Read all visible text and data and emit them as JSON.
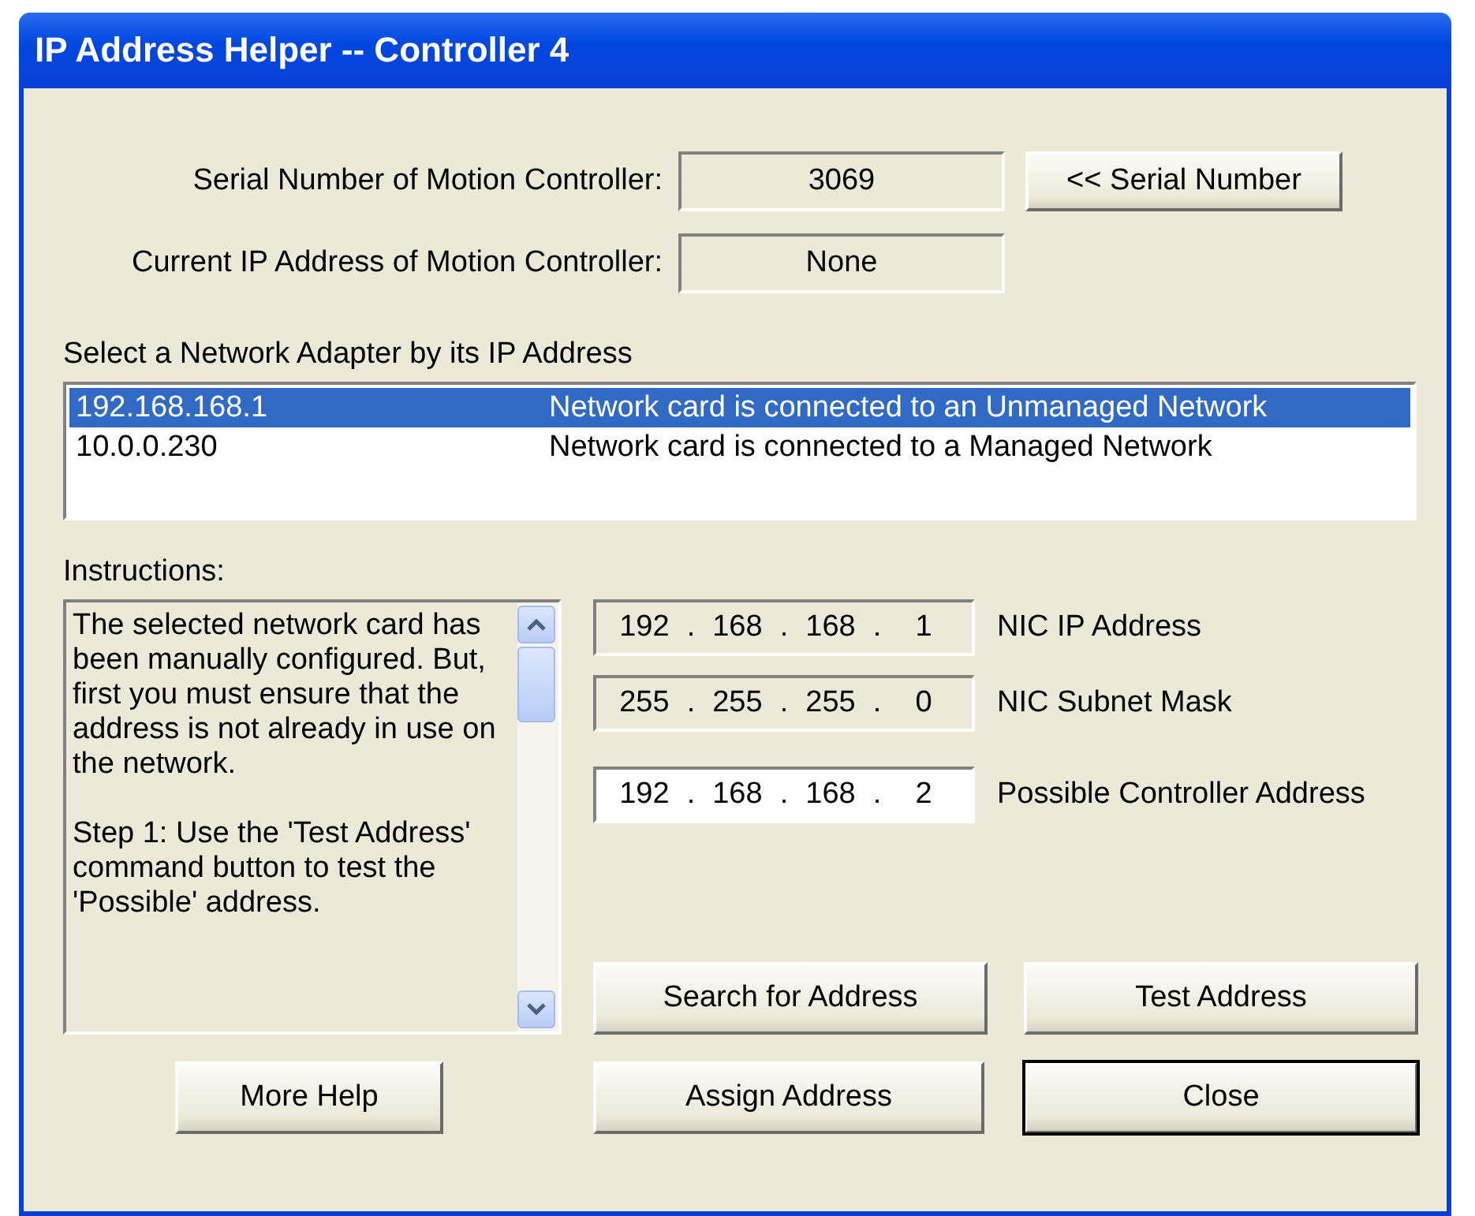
{
  "window": {
    "title": "IP Address Helper -- Controller 4"
  },
  "serial": {
    "label": "Serial Number of Motion Controller:",
    "value": "3069",
    "button": "<< Serial Number"
  },
  "current_ip": {
    "label": "Current IP Address of Motion Controller:",
    "value": "None"
  },
  "adapters": {
    "label": "Select a Network Adapter by its IP Address",
    "items": [
      {
        "address": "192.168.168.1",
        "description": "Network card is connected to an Unmanaged Network",
        "selected": true
      },
      {
        "address": "10.0.0.230",
        "description": "Network card is connected to a Managed Network",
        "selected": false
      }
    ]
  },
  "instructions": {
    "label": "Instructions:",
    "paragraphs": [
      "The selected network card has been manually configured.  But, first you must ensure that the address is not already in use on the network.",
      "Step 1: Use the 'Test Address' command button to test the 'Possible' address."
    ]
  },
  "addresses": [
    {
      "octets": [
        "192",
        "168",
        "168",
        "1"
      ],
      "separator": ".",
      "label": "NIC IP Address",
      "editable": false
    },
    {
      "octets": [
        "255",
        "255",
        "255",
        "0"
      ],
      "separator": ".",
      "label": "NIC Subnet Mask",
      "editable": false
    },
    {
      "octets": [
        "192",
        "168",
        "168",
        "2"
      ],
      "separator": ".",
      "label": "Possible Controller Address",
      "editable": true
    }
  ],
  "action_buttons": [
    "Search for Address",
    "Test Address"
  ],
  "bottom_buttons": [
    {
      "label": "More Help",
      "default": false
    },
    {
      "label": "Assign Address",
      "default": false
    },
    {
      "label": "Close",
      "default": true
    }
  ]
}
